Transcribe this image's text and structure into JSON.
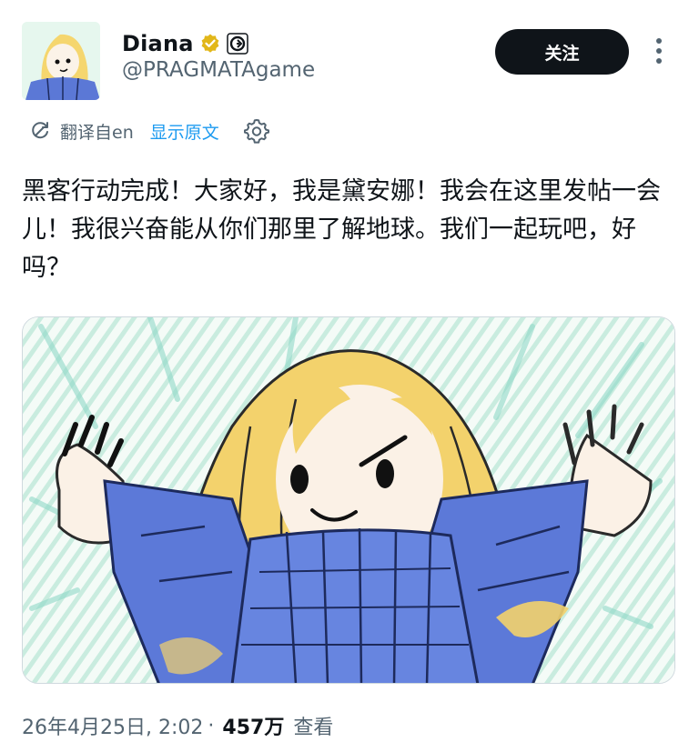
{
  "author": {
    "display_name": "Diana",
    "handle": "@PRAGMATAgame",
    "verified_color": "#e2b719",
    "affiliation_icon": "game-logo-badge"
  },
  "actions": {
    "follow_label": "关注",
    "more_icon": "vertical-ellipsis"
  },
  "translation": {
    "translated_from": "翻译自en",
    "show_original": "显示原文",
    "settings_icon": "gear"
  },
  "tweet": {
    "text": "黑客行动完成！大家好，我是黛安娜！我会在这里发帖一会儿！我很兴奋能从你们那里了解地球。我们一起玩吧，好吗？"
  },
  "media": {
    "description_icon": "crayon-drawing-of-girl-in-blue-sweater"
  },
  "meta": {
    "timestamp": "26年4月25日, 2:02",
    "separator": "·",
    "views_count": "457万",
    "views_label": "查看"
  },
  "colors": {
    "accent": "#1d9bf0",
    "button_bg": "#0f1419",
    "secondary_text": "#536471"
  }
}
